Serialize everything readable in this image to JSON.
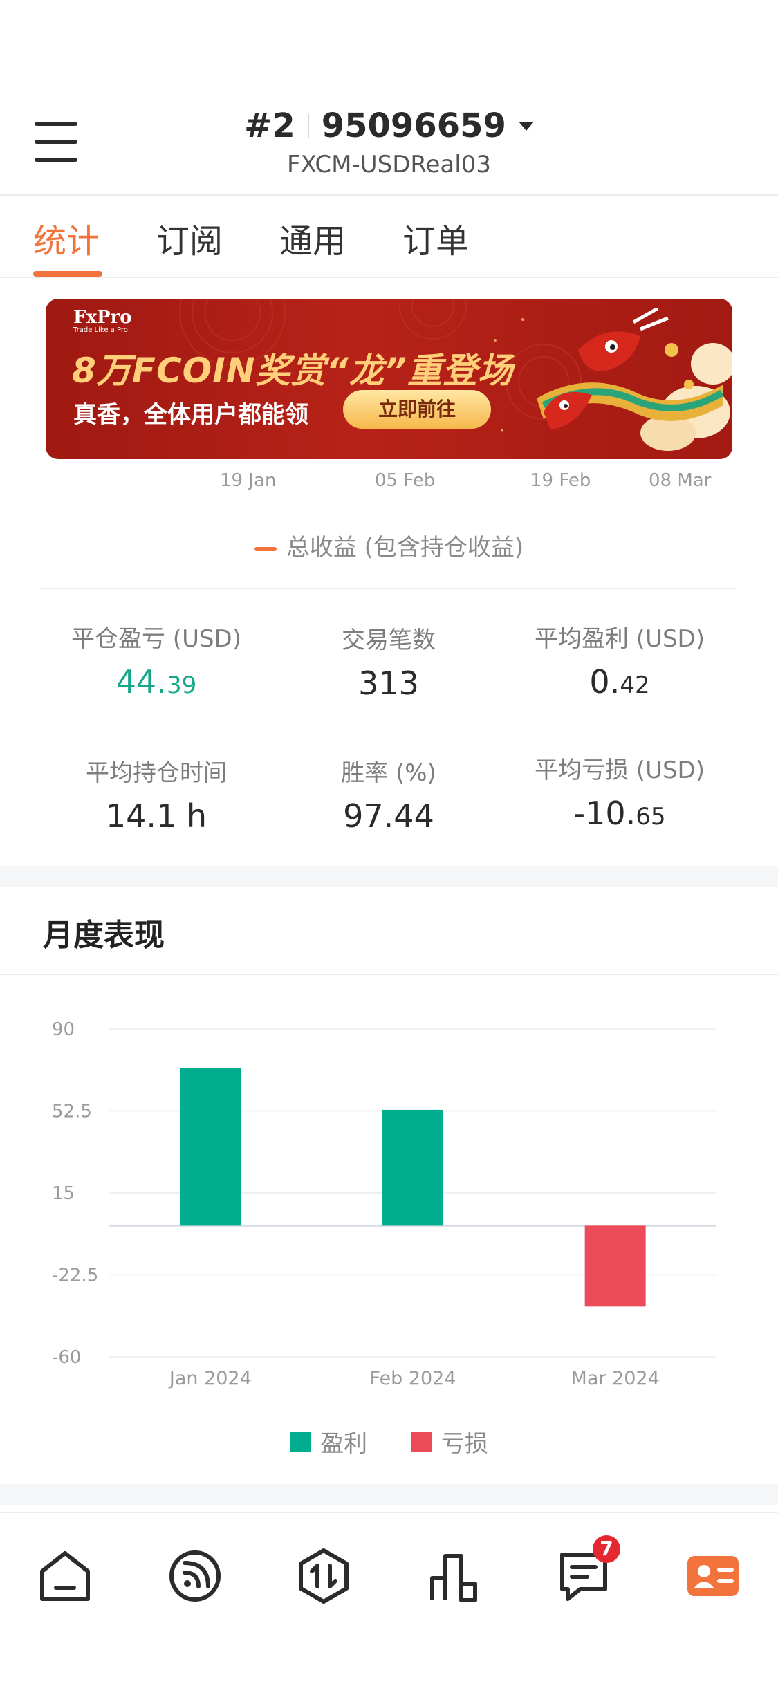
{
  "header": {
    "account_index": "#2",
    "account_number": "95096659",
    "server": "FXCM-USDReal03"
  },
  "tabs": [
    {
      "label": "统计",
      "active": true
    },
    {
      "label": "订阅",
      "active": false
    },
    {
      "label": "通用",
      "active": false
    },
    {
      "label": "订单",
      "active": false
    }
  ],
  "banner": {
    "brand": "FxPro",
    "tagline": "Trade Like a Pro",
    "headline": "8万FCOIN奖赏“龙”重登场",
    "subline": "真香，全体用户都能领",
    "cta": "立即前往"
  },
  "top_chart": {
    "x_ticks": [
      "19 Jan",
      "05 Feb",
      "19 Feb",
      "08 Mar"
    ],
    "legend": "总收益 (包含持仓收益)"
  },
  "stats": [
    {
      "label": "平仓盈亏 (USD)",
      "int": "44.",
      "dec": "39",
      "color": "#16a78a"
    },
    {
      "label": "交易笔数",
      "int": "313",
      "dec": "",
      "color": "#2b2b2b"
    },
    {
      "label": "平均盈利 (USD)",
      "int": "0.",
      "dec": "42",
      "color": "#2b2b2b"
    },
    {
      "label": "平均持仓时间",
      "int": "14.1 h",
      "dec": "",
      "color": "#2b2b2b"
    },
    {
      "label": "胜率 (%)",
      "int": "97.44",
      "dec": "",
      "color": "#2b2b2b"
    },
    {
      "label": "平均亏损 (USD)",
      "int": "-10.",
      "dec": "65",
      "color": "#2b2b2b"
    }
  ],
  "monthly": {
    "title": "月度表现"
  },
  "chart_data": {
    "type": "bar",
    "categories": [
      "Jan 2024",
      "Feb 2024",
      "Mar 2024"
    ],
    "values": [
      72,
      53,
      -37
    ],
    "ylim": [
      -60,
      90
    ],
    "yticks": [
      90,
      52.5,
      15,
      -22.5,
      -60
    ],
    "grid": true,
    "series_legend": [
      {
        "name": "盈利",
        "color": "#00ad8f"
      },
      {
        "name": "亏损",
        "color": "#ec4c5a"
      }
    ]
  },
  "bottom_nav": {
    "items": [
      "home-icon",
      "feed-icon",
      "trade-icon",
      "chart-icon",
      "message-icon",
      "profile-card-icon"
    ],
    "message_badge": "7",
    "accent": "#f2733b"
  }
}
